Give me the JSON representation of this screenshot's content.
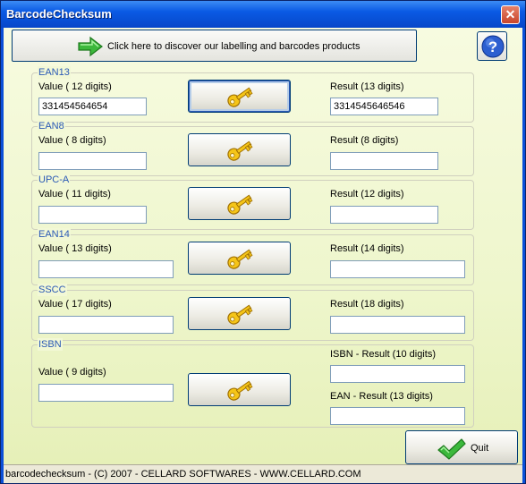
{
  "window": {
    "title": "BarcodeChecksum",
    "close_glyph": "✕"
  },
  "promo": {
    "label": "Click here to discover our labelling and barcodes products",
    "icon": "green-right-arrow-icon"
  },
  "help": {
    "glyph": "?",
    "icon": "help-icon"
  },
  "groups": {
    "ean13": {
      "title": "EAN13",
      "value_label": "Value ( 12 digits)",
      "value": "331454564654",
      "result_label": "Result (13 digits)",
      "result": "3314545646546"
    },
    "ean8": {
      "title": "EAN8",
      "value_label": "Value ( 8 digits)",
      "value": "",
      "result_label": "Result (8 digits)",
      "result": ""
    },
    "upca": {
      "title": "UPC-A",
      "value_label": "Value ( 11 digits)",
      "value": "",
      "result_label": "Result (12 digits)",
      "result": ""
    },
    "ean14": {
      "title": "EAN14",
      "value_label": "Value ( 13 digits)",
      "value": "",
      "result_label": "Result (14 digits)",
      "result": ""
    },
    "sscc": {
      "title": "SSCC",
      "value_label": "Value ( 17 digits)",
      "value": "",
      "result_label": "Result (18 digits)",
      "result": ""
    },
    "isbn": {
      "title": "ISBN",
      "value_label": "Value ( 9 digits)",
      "value": "",
      "result_label_isbn": "ISBN - Result (10 digits)",
      "result_isbn": "",
      "result_label_ean": "EAN - Result (13 digits)",
      "result_ean": ""
    }
  },
  "quit": {
    "label": "Quit",
    "icon": "green-check-icon"
  },
  "status": {
    "text": "barcodechecksum - (C) 2007 - CELLARD SOFTWARES - WWW.CELLARD.COM"
  },
  "colors": {
    "titlebar": "#0a5ae4",
    "group_title": "#2a59b5",
    "background": "#eef6cc",
    "key": "#f0c020"
  }
}
